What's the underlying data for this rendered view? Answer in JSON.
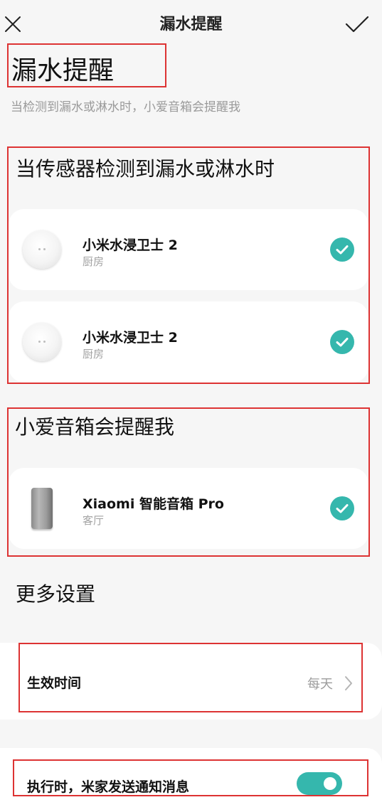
{
  "topbar": {
    "title": "漏水提醒",
    "close_icon": "close-icon",
    "confirm_icon": "check-icon"
  },
  "page": {
    "title": "漏水提醒",
    "subtitle": "当检测到漏水或淋水时，小爱音箱会提醒我"
  },
  "sensors_section": {
    "title": "当传感器检测到漏水或淋水时",
    "devices": [
      {
        "name": "小米水浸卫士 2",
        "room": "厨房",
        "icon": "water-sensor-icon",
        "selected": true
      },
      {
        "name": "小米水浸卫士 2",
        "room": "厨房",
        "icon": "water-sensor-icon",
        "selected": true
      }
    ]
  },
  "speaker_section": {
    "title": "小爱音箱会提醒我",
    "devices": [
      {
        "name": "Xiaomi 智能音箱 Pro",
        "room": "客厅",
        "icon": "speaker-icon",
        "selected": true
      }
    ]
  },
  "more_settings": {
    "title": "更多设置",
    "effective_time": {
      "label": "生效时间",
      "value": "每天"
    },
    "notify": {
      "label": "执行时，米家发送通知消息",
      "enabled": true
    }
  },
  "colors": {
    "accent": "#35b7ad",
    "highlight": "#dd3333",
    "background": "#f6f6f6"
  }
}
